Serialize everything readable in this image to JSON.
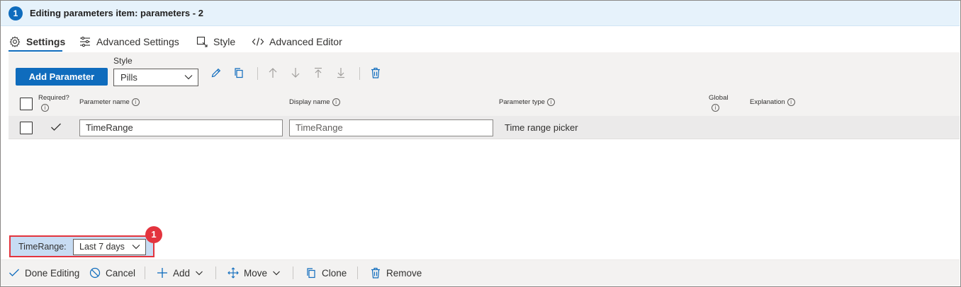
{
  "header": {
    "step": "1",
    "title": "Editing parameters item: parameters - 2"
  },
  "tabs": [
    {
      "label": "Settings",
      "icon": "gear-icon",
      "active": true
    },
    {
      "label": "Advanced Settings",
      "icon": "sliders-icon",
      "active": false
    },
    {
      "label": "Style",
      "icon": "style-icon",
      "active": false
    },
    {
      "label": "Advanced Editor",
      "icon": "code-icon",
      "active": false
    }
  ],
  "toolbar": {
    "add_label": "Add Parameter",
    "style_label": "Style",
    "style_value": "Pills",
    "icons": [
      "edit-icon",
      "copy-icon",
      "move-up-icon",
      "move-down-icon",
      "move-top-icon",
      "move-bottom-icon",
      "delete-icon"
    ]
  },
  "table": {
    "columns": {
      "required": "Required?",
      "name": "Parameter name",
      "display": "Display name",
      "type": "Parameter type",
      "global": "Global",
      "explanation": "Explanation"
    },
    "rows": [
      {
        "required": true,
        "name": "TimeRange",
        "display": "TimeRange",
        "type": "Time range picker"
      }
    ]
  },
  "preview": {
    "label": "TimeRange:",
    "value": "Last 7 days",
    "callout": "1"
  },
  "footer": {
    "done": "Done Editing",
    "cancel": "Cancel",
    "add": "Add",
    "move": "Move",
    "clone": "Clone",
    "remove": "Remove"
  },
  "colors": {
    "accent": "#0f6cbd",
    "header_bg": "#e6f2fb",
    "callout": "#e3343e",
    "preview_bg": "#c7dcf3"
  }
}
